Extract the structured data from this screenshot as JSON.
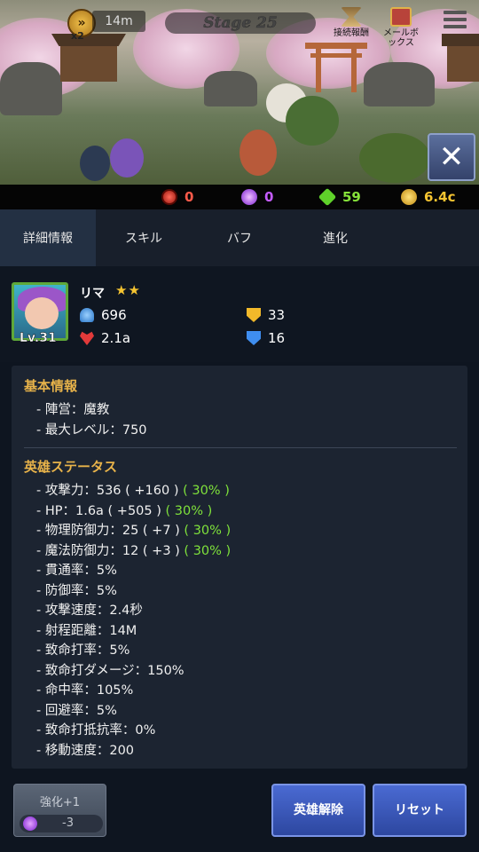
{
  "topbar": {
    "speed_multiplier": "x2",
    "distance": "14m",
    "stage": "Stage 25",
    "connection_reward_label": "接続報酬",
    "mailbox_label": "メールボックス"
  },
  "resources": [
    {
      "name": "red-token",
      "value": "0",
      "color": "#ff5a4a"
    },
    {
      "name": "purple-orb",
      "value": "0",
      "color": "#c45cff"
    },
    {
      "name": "green-gem",
      "value": "59",
      "color": "#86e23a"
    },
    {
      "name": "gold",
      "value": "6.4c",
      "color": "#f5c431"
    }
  ],
  "tabs": [
    {
      "label": "詳細情報",
      "active": true
    },
    {
      "label": "スキル",
      "active": false
    },
    {
      "label": "バフ",
      "active": false
    },
    {
      "label": "進化",
      "active": false
    }
  ],
  "hero": {
    "name": "リマ",
    "stars": "★★",
    "level": "Lv.31",
    "attack": "696",
    "hp": "2.1a",
    "physical_defense": "33",
    "magic_defense": "16"
  },
  "basic_info": {
    "title": "基本情報",
    "lines": [
      "- 陣営：魔教",
      "- 最大レベル：750"
    ]
  },
  "status": {
    "title": "英雄ステータス",
    "lines": [
      {
        "text": "- 攻撃力：536 ( +160 ) ",
        "bonus": "( 30% )"
      },
      {
        "text": "- HP：1.6a ( +505 ) ",
        "bonus": "( 30% )"
      },
      {
        "text": "- 物理防御力：25 ( +7 ) ",
        "bonus": "( 30% )"
      },
      {
        "text": "- 魔法防御力：12 ( +3 ) ",
        "bonus": "( 30% )"
      },
      {
        "text": "- 貫通率：5%",
        "bonus": ""
      },
      {
        "text": "- 防御率：5%",
        "bonus": ""
      },
      {
        "text": "- 攻撃速度：2.4秒",
        "bonus": ""
      },
      {
        "text": "- 射程距離：14M",
        "bonus": ""
      },
      {
        "text": "- 致命打率：5%",
        "bonus": ""
      },
      {
        "text": "- 致命打ダメージ：150%",
        "bonus": ""
      },
      {
        "text": "- 命中率：105%",
        "bonus": ""
      },
      {
        "text": "- 回避率：5%",
        "bonus": ""
      },
      {
        "text": "- 致命打抵抗率：0%",
        "bonus": ""
      },
      {
        "text": "- 移動速度：200",
        "bonus": ""
      }
    ]
  },
  "buttons": {
    "upgrade_label": "強化+1",
    "upgrade_cost": "-3",
    "release_label": "英雄解除",
    "reset_label": "リセット"
  }
}
